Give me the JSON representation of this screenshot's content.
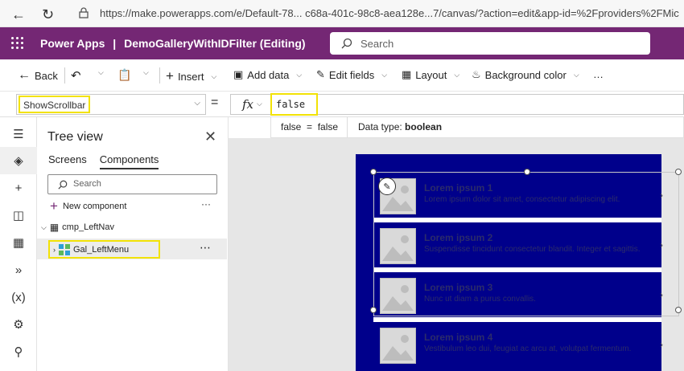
{
  "browser": {
    "url": "https://make.powerapps.com/e/Default-78... c68a-401c-98c8-aea128e...7/canvas/?action=edit&app-id=%2Fproviders%2FMicroso"
  },
  "header": {
    "app_name": "Power Apps",
    "divider": "|",
    "app_title": "DemoGalleryWithIDFilter (Editing)",
    "search_placeholder": "Search"
  },
  "commandbar": {
    "back": "Back",
    "insert": "Insert",
    "add_data": "Add data",
    "edit_fields": "Edit fields",
    "layout": "Layout",
    "background_color": "Background color",
    "more": "…"
  },
  "formula": {
    "property": "ShowScrollbar",
    "equals": "=",
    "fx": "fx",
    "value": "false"
  },
  "hint": {
    "result": "false  =  false",
    "data_type_label": "Data type:",
    "data_type_value": "boolean"
  },
  "tree": {
    "title": "Tree view",
    "tabs": [
      "Screens",
      "Components"
    ],
    "search_placeholder": "Search",
    "new_component": "New component",
    "dots": "···",
    "component": "cmp_LeftNav",
    "gallery": "Gal_LeftMenu",
    "more": "⋯"
  },
  "gallery": {
    "items": [
      {
        "title": "Lorem ipsum 1",
        "subtitle": "Lorem ipsum dolor sit amet, consectetur adipiscing elit."
      },
      {
        "title": "Lorem ipsum 2",
        "subtitle": "Suspendisse tincidunt consectetur blandit. Integer et sagittis."
      },
      {
        "title": "Lorem ipsum 3",
        "subtitle": "Nunc ut diam a purus convallis."
      },
      {
        "title": "Lorem ipsum 4",
        "subtitle": "Vestibulum leo dui, feugiat ac arcu at, volutpat fermentum."
      }
    ]
  },
  "colors": {
    "header_bg": "#742774",
    "screen_bg": "#00008b",
    "highlight": "#f2e205"
  }
}
